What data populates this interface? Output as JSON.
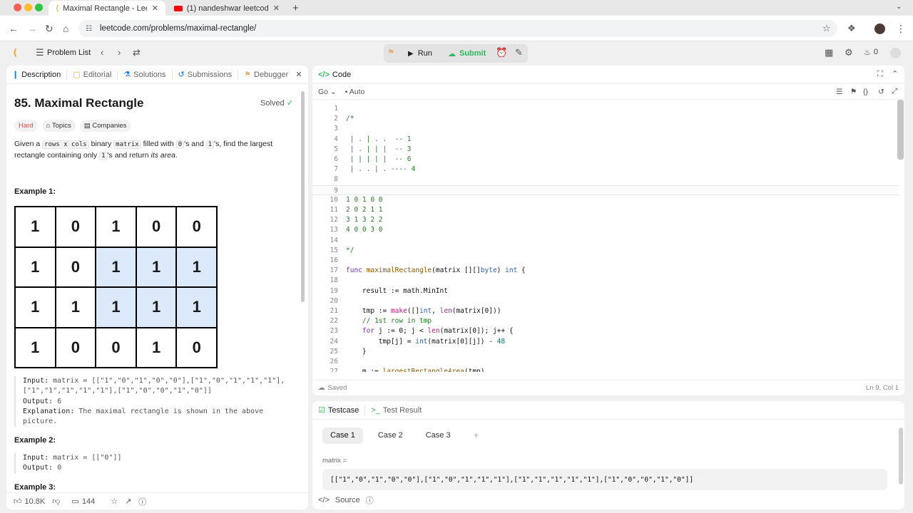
{
  "browser": {
    "tabs": [
      {
        "title": "Maximal Rectangle - LeetCode",
        "active": true
      },
      {
        "title": "(1) nandeshwar leetcode - YouTube",
        "active": false
      }
    ],
    "url": "leetcode.com/problems/maximal-rectangle/"
  },
  "header": {
    "problem_list_label": "Problem List",
    "run_label": "Run",
    "submit_label": "Submit",
    "streak_count": "0"
  },
  "description_panel": {
    "tabs": [
      "Description",
      "Editorial",
      "Solutions",
      "Submissions",
      "Debugger"
    ],
    "title": "85. Maximal Rectangle",
    "status": "Solved",
    "difficulty": "Hard",
    "topics_label": "Topics",
    "companies_label": "Companies",
    "statement": {
      "t1": "Given a ",
      "c1": "rows x cols",
      "t2": " binary ",
      "c2": "matrix",
      "t3": " filled with ",
      "c3": "0",
      "t4": "'s and ",
      "c4": "1",
      "t5": "'s, find the largest rectangle containing only ",
      "c5": "1",
      "t6": "'s and return ",
      "t7": "its area",
      "t8": "."
    },
    "example1": {
      "heading": "Example 1:",
      "matrix": [
        [
          "1",
          "0",
          "1",
          "0",
          "0"
        ],
        [
          "1",
          "0",
          "1",
          "1",
          "1"
        ],
        [
          "1",
          "1",
          "1",
          "1",
          "1"
        ],
        [
          "1",
          "0",
          "0",
          "1",
          "0"
        ]
      ],
      "highlight": [
        [
          1,
          2
        ],
        [
          1,
          3
        ],
        [
          1,
          4
        ],
        [
          2,
          2
        ],
        [
          2,
          3
        ],
        [
          2,
          4
        ]
      ],
      "input_label": "Input:",
      "input_value": "matrix = [[\"1\",\"0\",\"1\",\"0\",\"0\"],[\"1\",\"0\",\"1\",\"1\",\"1\"],[\"1\",\"1\",\"1\",\"1\",\"1\"],[\"1\",\"0\",\"0\",\"1\",\"0\"]]",
      "output_label": "Output:",
      "output_value": "6",
      "explanation_label": "Explanation:",
      "explanation_value": "The maximal rectangle is shown in the above picture."
    },
    "example2": {
      "heading": "Example 2:",
      "input_label": "Input:",
      "input_value": "matrix = [[\"0\"]]",
      "output_label": "Output:",
      "output_value": "0"
    },
    "example3_heading": "Example 3:",
    "footer": {
      "likes": "10.8K",
      "comments": "144"
    }
  },
  "code_panel": {
    "title": "Code",
    "language": "Go",
    "mode": "Auto",
    "lines": [
      "",
      "/*",
      "",
      " | . | . .  -- 1",
      " | . | | |  -- 3",
      " | | | | |  -- 6",
      " | . . | . ---- 4",
      "",
      "",
      "1 0 1 0 0",
      "2 0 2 1 1",
      "3 1 3 2 2",
      "4 0 0 3 0",
      "",
      "*/",
      "",
      "func maximalRectangle(matrix [][]byte) int {",
      "",
      "    result := math.MinInt",
      "",
      "    tmp := make([]int, len(matrix[0]))",
      "    // 1st row in tmp",
      "    for j := 0; j < len(matrix[0]); j++ {",
      "        tmp[j] = int(matrix[0][j]) - 48",
      "    }",
      "",
      "    m := largestRectangleArea(tmp)"
    ],
    "current_line": 9,
    "saved_label": "Saved",
    "cursor_position": "Ln 9, Col 1"
  },
  "test_panel": {
    "tabs": [
      "Testcase",
      "Test Result"
    ],
    "cases": [
      "Case 1",
      "Case 2",
      "Case 3"
    ],
    "param_label": "matrix =",
    "param_value": "[[\"1\",\"0\",\"1\",\"0\",\"0\"],[\"1\",\"0\",\"1\",\"1\",\"1\"],[\"1\",\"1\",\"1\",\"1\",\"1\"],[\"1\",\"0\",\"0\",\"1\",\"0\"]]",
    "source_label": "Source"
  },
  "colors": {
    "accent": "#2cbb5d",
    "hard": "#ef4743",
    "highlight_cell": "#dbe9fb",
    "blue": "#007aff"
  }
}
